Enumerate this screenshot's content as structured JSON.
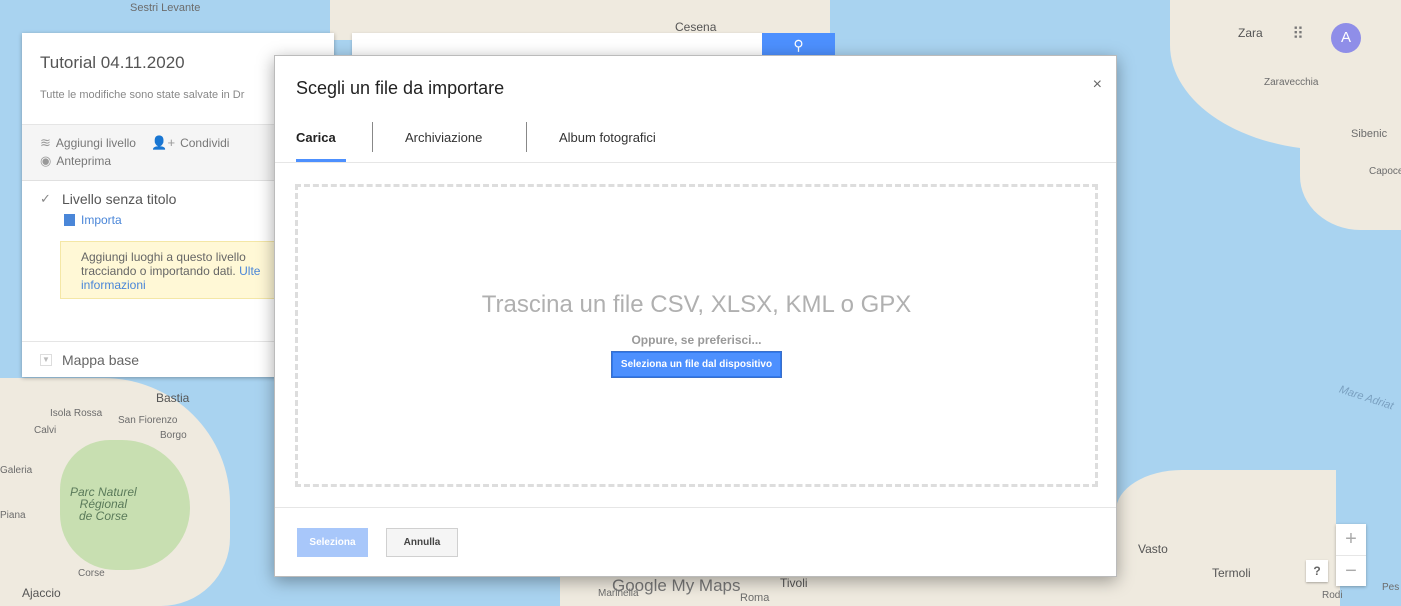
{
  "map": {
    "labels": {
      "sestri": "Sestri Levante",
      "cesena": "Cesena",
      "zara": "Zara",
      "zaravecchia": "Zaravecchia",
      "sibenik": "Sibenic",
      "capocesto": "Capoce",
      "bastia": "Bastia",
      "isola_rossa": "Isola Rossa",
      "san_fiorenzo": "San Fiorenzo",
      "calvi": "Calvi",
      "borgo": "Borgo",
      "galeria": "Galeria",
      "parc": "Parc Naturel\nRégional\nde Corse",
      "piana": "Piana",
      "corse": "Corse",
      "ajaccio": "Ajaccio",
      "mare": "Mare Adriat",
      "vasto": "Vasto",
      "termoli": "Termoli",
      "marinella": "Marinella",
      "tivoli": "Tivoli",
      "roma": "Roma",
      "rodi": "Rodi",
      "pes": "Pes"
    },
    "brand": "Google My Maps"
  },
  "panel": {
    "title": "Tutorial 04.11.2020",
    "save_status": "Tutte le modifiche sono state salvate in Dr",
    "add_layer": "Aggiungi livello",
    "share": "Condividi",
    "preview": "Anteprima",
    "layer_name": "Livello senza titolo",
    "import": "Importa",
    "hint_text": "Aggiungi luoghi a questo livello tracciando o importando dati.",
    "hint_link_1": "Ulte",
    "hint_link_2": "informazioni",
    "basemap": "Mappa base"
  },
  "topright": {
    "avatar_letter": "A"
  },
  "controls": {
    "zoom_in": "+",
    "zoom_out": "−",
    "help": "?"
  },
  "dialog": {
    "title": "Scegli un file da importare",
    "close": "×",
    "tabs": [
      "Carica",
      "Archiviazione",
      "Album fotografici"
    ],
    "drop_text": "Trascina un file CSV, XLSX, KML o GPX",
    "or_text": "Oppure, se preferisci...",
    "pick_button": "Seleziona un file dal dispositivo",
    "select_button": "Seleziona",
    "cancel_button": "Annulla"
  }
}
